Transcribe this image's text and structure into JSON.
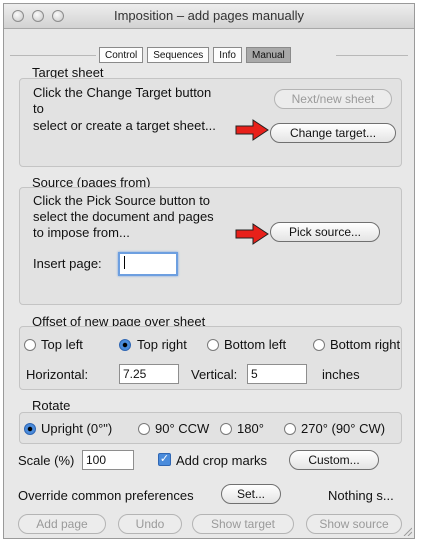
{
  "window": {
    "title": "Imposition – add pages manually"
  },
  "tabs": [
    {
      "label": "Control",
      "selected": false
    },
    {
      "label": "Sequences",
      "selected": false
    },
    {
      "label": "Info",
      "selected": false
    },
    {
      "label": "Manual",
      "selected": true
    }
  ],
  "target_sheet": {
    "title": "Target sheet",
    "line1": "Click the Change Target button",
    "line2": "to",
    "line3": "select or create a target sheet...",
    "next_button": "Next/new sheet",
    "change_button": "Change target..."
  },
  "source": {
    "title": "Source (pages from)",
    "line1": "Click the Pick Source button to",
    "line2": "select the document and pages",
    "line3": "to impose from...",
    "pick_button": "Pick source...",
    "insert_label": "Insert page:",
    "insert_value": ""
  },
  "offset": {
    "title": "Offset of new page over sheet",
    "options": [
      {
        "label": "Top left",
        "selected": false
      },
      {
        "label": "Top right",
        "selected": true
      },
      {
        "label": "Bottom left",
        "selected": false
      },
      {
        "label": "Bottom right",
        "selected": false
      }
    ],
    "horizontal_label": "Horizontal:",
    "horizontal_value": "7.25",
    "vertical_label": "Vertical:",
    "vertical_value": "5",
    "units": "inches"
  },
  "rotate": {
    "title": "Rotate",
    "options": [
      {
        "label": "Upright (0°\")",
        "selected": true
      },
      {
        "label": "90° CCW",
        "selected": false
      },
      {
        "label": "180°",
        "selected": false
      },
      {
        "label": "270° (90° CW)",
        "selected": false
      }
    ]
  },
  "scale": {
    "label": "Scale (%)",
    "value": "100"
  },
  "crop_marks": {
    "label": "Add crop marks",
    "checked": true
  },
  "custom_button": "Custom...",
  "override": {
    "label": "Override common preferences",
    "set_button": "Set...",
    "status": "Nothing s..."
  },
  "bottom_buttons": {
    "add_page": "Add page",
    "undo": "Undo",
    "show_target": "Show target",
    "show_source": "Show source"
  },
  "colors": {
    "arrow_red": "#e8201a",
    "radio_blue": "#4a8bdb",
    "focus_ring": "#6d9fe0"
  }
}
